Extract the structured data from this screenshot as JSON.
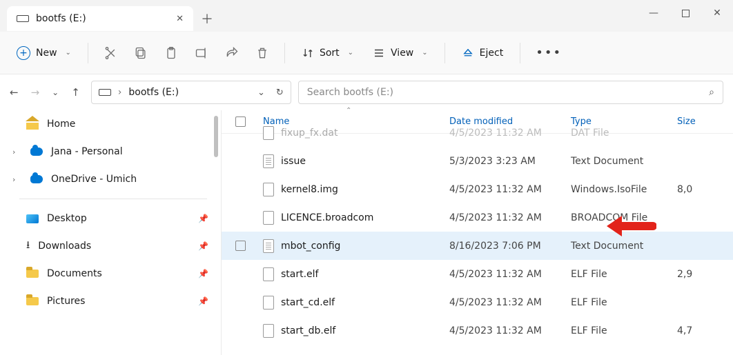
{
  "tab": {
    "title": "bootfs (E:)"
  },
  "toolbar": {
    "new_label": "New",
    "sort_label": "Sort",
    "view_label": "View",
    "eject_label": "Eject"
  },
  "addressbar": {
    "breadcrumb_sep": "›",
    "location": "bootfs (E:)"
  },
  "search": {
    "placeholder": "Search bootfs (E:)"
  },
  "sidebar": {
    "home": "Home",
    "personal": "Jana - Personal",
    "onedrive": "OneDrive - Umich",
    "quick": {
      "desktop": "Desktop",
      "downloads": "Downloads",
      "documents": "Documents",
      "pictures": "Pictures"
    }
  },
  "columns": {
    "name": "Name",
    "date": "Date modified",
    "type": "Type",
    "size": "Size"
  },
  "files": [
    {
      "name": "fixup_fx.dat",
      "date": "4/5/2023 11:32 AM",
      "type": "DAT File",
      "size": "",
      "icon": "file",
      "cut": true
    },
    {
      "name": "issue",
      "date": "5/3/2023 3:23 AM",
      "type": "Text Document",
      "size": "",
      "icon": "text"
    },
    {
      "name": "kernel8.img",
      "date": "4/5/2023 11:32 AM",
      "type": "Windows.IsoFile",
      "size": "8,0",
      "icon": "file"
    },
    {
      "name": "LICENCE.broadcom",
      "date": "4/5/2023 11:32 AM",
      "type": "BROADCOM File",
      "size": "",
      "icon": "file"
    },
    {
      "name": "mbot_config",
      "date": "8/16/2023 7:06 PM",
      "type": "Text Document",
      "size": "",
      "icon": "text",
      "selected": true
    },
    {
      "name": "start.elf",
      "date": "4/5/2023 11:32 AM",
      "type": "ELF File",
      "size": "2,9",
      "icon": "file"
    },
    {
      "name": "start_cd.elf",
      "date": "4/5/2023 11:32 AM",
      "type": "ELF File",
      "size": "",
      "icon": "file"
    },
    {
      "name": "start_db.elf",
      "date": "4/5/2023 11:32 AM",
      "type": "ELF File",
      "size": "4,7",
      "icon": "file"
    }
  ]
}
